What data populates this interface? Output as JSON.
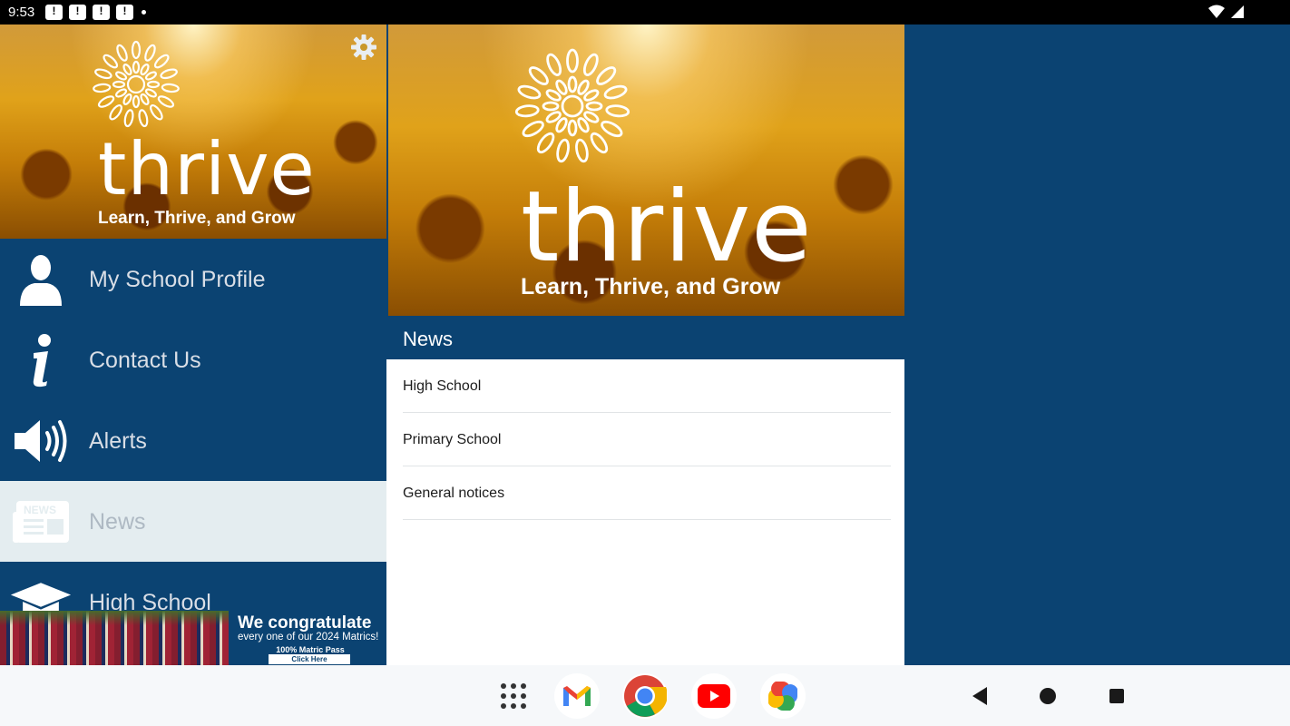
{
  "status_bar": {
    "time": "9:53",
    "notification_count": 4
  },
  "hero": {
    "brand": "thrive",
    "tagline": "Learn, Thrive, and Grow"
  },
  "drawer": {
    "items": [
      {
        "label": "My School Profile",
        "icon": "person-icon"
      },
      {
        "label": "Contact Us",
        "icon": "info-icon"
      },
      {
        "label": "Alerts",
        "icon": "speaker-icon"
      },
      {
        "label": "News",
        "icon": "newspaper-icon",
        "active": true
      },
      {
        "label": "High School",
        "icon": "graduation-cap-icon"
      }
    ]
  },
  "banner": {
    "title": "We congratulate",
    "subtitle": "every one of our 2024 Matrics!",
    "pass": "100% Matric Pass",
    "button": "Click Here"
  },
  "news": {
    "header": "News",
    "items": [
      {
        "label": "High School"
      },
      {
        "label": "Primary School"
      },
      {
        "label": "General notices"
      }
    ]
  },
  "navbar": {
    "apps": [
      "app-drawer-icon",
      "gmail-icon",
      "chrome-icon",
      "youtube-icon",
      "photos-icon"
    ],
    "buttons": [
      "back-button",
      "home-button",
      "recents-button"
    ]
  },
  "colors": {
    "primary": "#0b4372",
    "active_item": "#e4edf0",
    "nav_background": "#f6f8fa"
  }
}
